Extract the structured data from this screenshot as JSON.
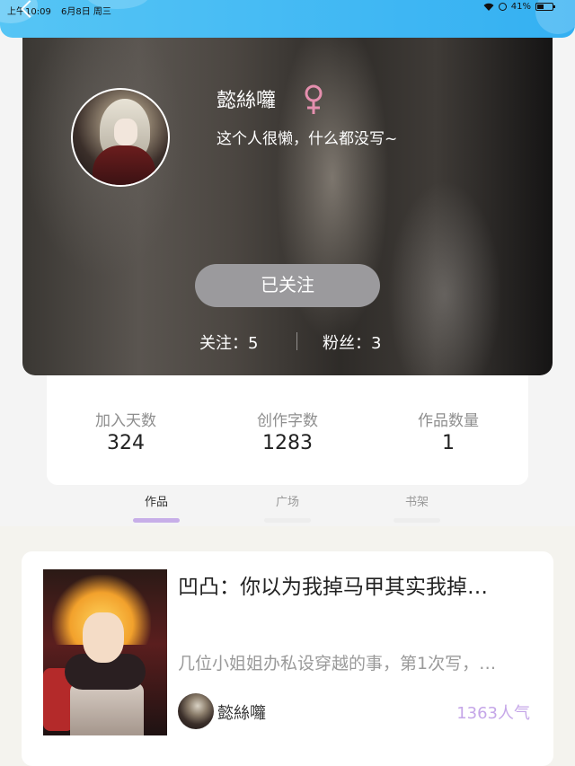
{
  "status_bar": {
    "time": "上午10:09",
    "date": "6月8日 周三",
    "battery": "41%"
  },
  "profile": {
    "username": "懿絲囖",
    "gender_symbol": "♀",
    "gender_color": "#e58fae",
    "bio": "这个人很懒，什么都没写~",
    "follow_button": "已关注",
    "following_label": "关注：5",
    "fans_label": "粉丝：3"
  },
  "stats": [
    {
      "label": "加入天数",
      "value": "324"
    },
    {
      "label": "创作字数",
      "value": "1283"
    },
    {
      "label": "作品数量",
      "value": "1"
    }
  ],
  "tabs": [
    {
      "label": "作品",
      "active": true
    },
    {
      "label": "广场",
      "active": false
    },
    {
      "label": "书架",
      "active": false
    }
  ],
  "works": [
    {
      "title": "凹凸：你以为我掉马甲其实我掉…",
      "description": "几位小姐姐办私设穿越的事，第1次写，…",
      "author": "懿絲囖",
      "popularity": "1363人气"
    }
  ],
  "colors": {
    "header": "#3cb6f3",
    "accent_purple": "#c5a6e8",
    "follow_button": "#9b9a9d"
  }
}
